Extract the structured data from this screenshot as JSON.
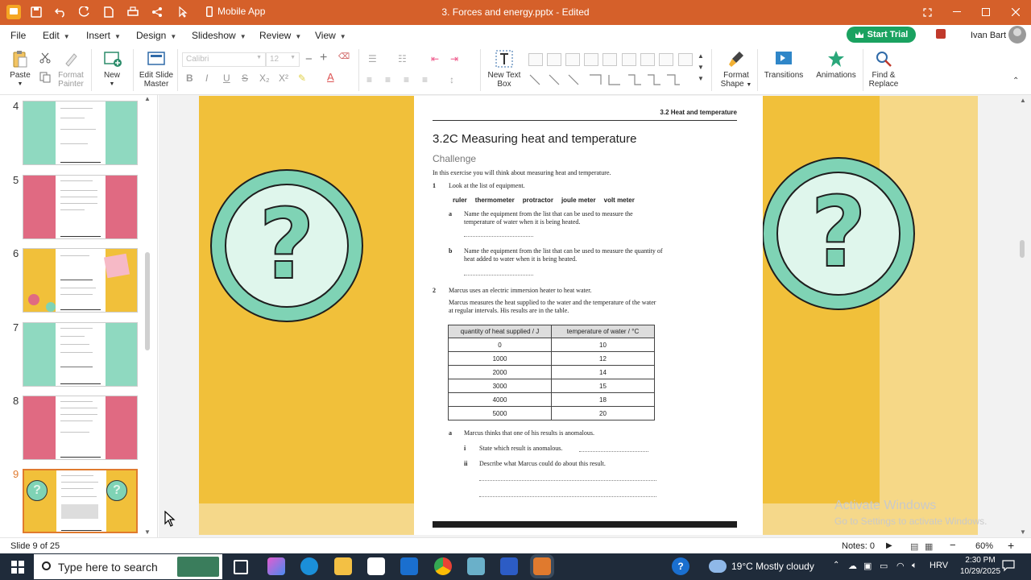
{
  "titlebar": {
    "mobile_app": "Mobile App",
    "doc_title": "3. Forces and energy.pptx - Edited"
  },
  "menu": {
    "items": [
      "File",
      "Edit",
      "Insert",
      "Design",
      "Slideshow",
      "Review",
      "View"
    ],
    "start_trial": "Start Trial",
    "user_name": "Ivan Bart"
  },
  "ribbon": {
    "paste": "Paste",
    "format_painter": [
      "Format",
      "Painter"
    ],
    "new": "New",
    "edit_slide_master": [
      "Edit Slide",
      "Master"
    ],
    "font_name": "Calibri",
    "font_size": "12",
    "new_text_box": [
      "New Text",
      "Box"
    ],
    "format_shape": [
      "Format",
      "Shape"
    ],
    "transitions": "Transitions",
    "animations": "Animations",
    "find_replace": [
      "Find &",
      "Replace"
    ]
  },
  "panel": {
    "slide_numbers": [
      "4",
      "5",
      "6",
      "7",
      "8",
      "9"
    ],
    "selected": "9"
  },
  "document": {
    "header": "3.2  Heat and temperature",
    "title": "3.2C Measuring heat and temperature",
    "subtitle": "Challenge",
    "intro": "In this exercise you will think about measuring heat and temperature.",
    "q1_num": "1",
    "q1": "Look at the list of equipment.",
    "equipment": [
      "ruler",
      "thermometer",
      "protractor",
      "joule meter",
      "volt meter"
    ],
    "q1a_label": "a",
    "q1a": "Name the equipment from the list that can be used to measure the temperature of water when it is being heated.",
    "q1b_label": "b",
    "q1b": "Name the equipment from the list that can be used to measure the quantity of heat added to water when it is being heated.",
    "q2_num": "2",
    "q2": "Marcus uses an electric immersion heater to heat water.",
    "q2_detail": "Marcus measures the heat supplied to the water and the temperature of the water at regular intervals. His results are in the table.",
    "table": {
      "headers": [
        "quantity of heat supplied / J",
        "temperature of water / °C"
      ],
      "rows": [
        [
          "0",
          "10"
        ],
        [
          "1000",
          "12"
        ],
        [
          "2000",
          "14"
        ],
        [
          "3000",
          "15"
        ],
        [
          "4000",
          "18"
        ],
        [
          "5000",
          "20"
        ]
      ]
    },
    "q2a_label": "a",
    "q2a": "Marcus thinks that one of his results is anomalous.",
    "q2a_i_label": "i",
    "q2a_i": "State which result is anomalous.",
    "q2a_ii_label": "ii",
    "q2a_ii": "Describe what Marcus could do about this result."
  },
  "watermark": {
    "line1": "Activate Windows",
    "line2": "Go to Settings to activate Windows."
  },
  "status": {
    "slide": "Slide 9 of 25",
    "notes": "Notes: 0",
    "zoom": "60%"
  },
  "taskbar": {
    "search_placeholder": "Type here to search",
    "weather": "19°C  Mostly cloudy",
    "lang": "HRV",
    "time": "2:30 PM",
    "date": "10/29/2025"
  },
  "colors": {
    "accent": "#d5602a",
    "slide_yellow": "#f1c03a",
    "circle_green": "#7fd3b5",
    "start_trial": "#1aa260"
  }
}
